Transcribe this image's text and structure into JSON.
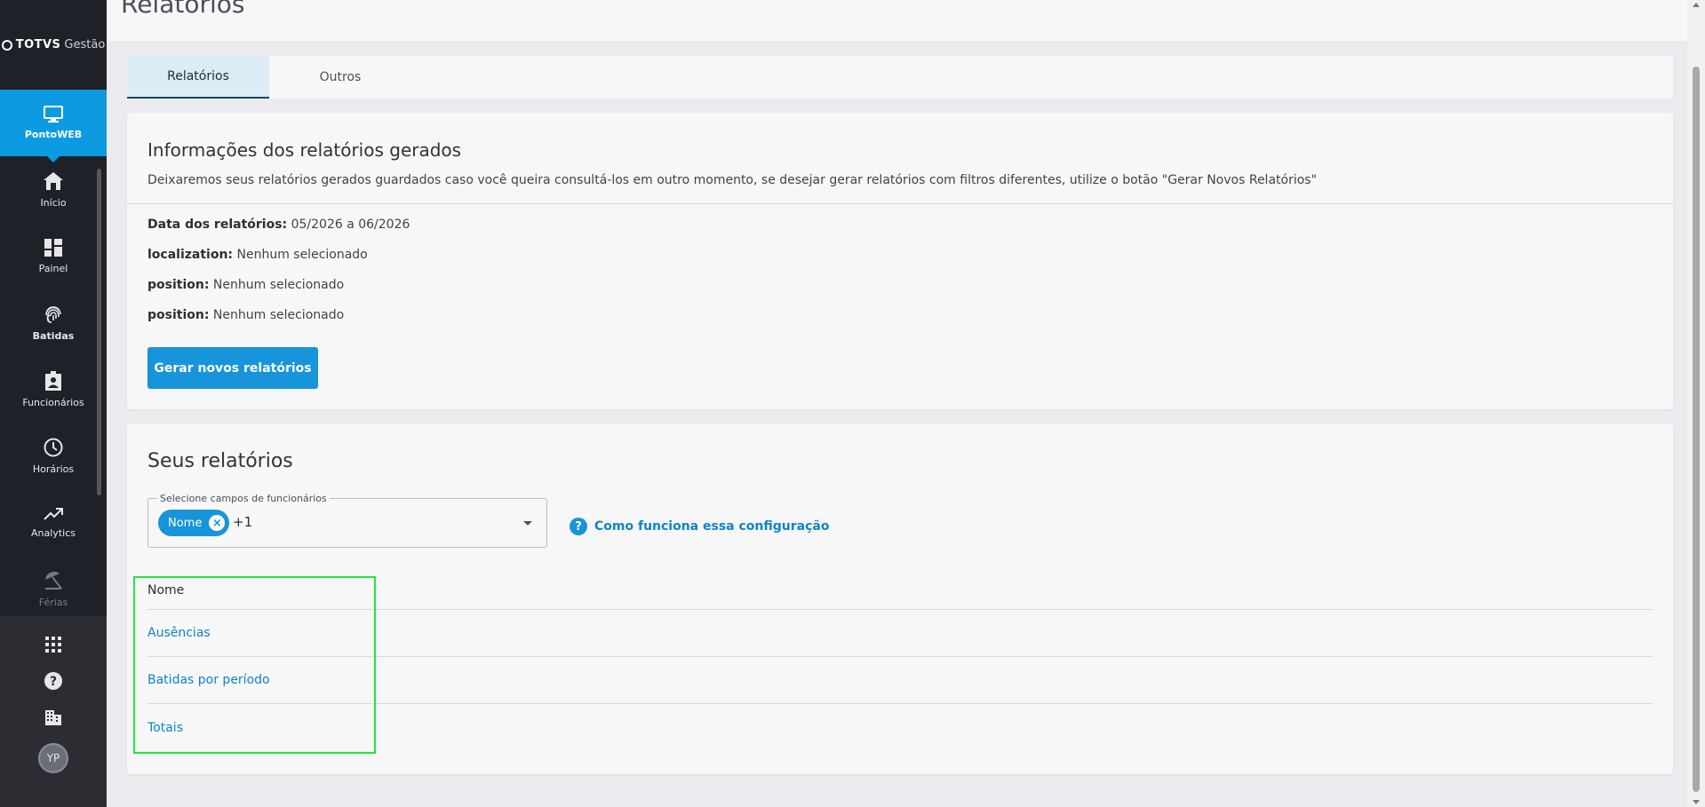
{
  "brand": {
    "name": "TOTVS",
    "suffix": "Gestão"
  },
  "sidebar": {
    "active_module": {
      "label": "PontoWEB",
      "icon": "monitor-icon"
    },
    "items": [
      {
        "label": "Início",
        "icon": "home-icon"
      },
      {
        "label": "Painel",
        "icon": "dashboard-icon"
      },
      {
        "label": "Batidas",
        "icon": "fingerprint-icon"
      },
      {
        "label": "Funcionários",
        "icon": "badge-icon"
      },
      {
        "label": "Horários",
        "icon": "clock-icon"
      },
      {
        "label": "Analytics",
        "icon": "trending-up-icon"
      },
      {
        "label": "Férias",
        "icon": "beach-umbrella-icon"
      }
    ],
    "bottom": {
      "apps_icon": "apps-grid-icon",
      "help_icon": "help-icon",
      "company_icon": "building-icon",
      "avatar_initials": "YP"
    }
  },
  "page": {
    "title": "Relatórios"
  },
  "tabs": [
    {
      "label": "Relatórios",
      "active": true
    },
    {
      "label": "Outros",
      "active": false
    }
  ],
  "info_card": {
    "title": "Informações dos relatórios gerados",
    "description": "Deixaremos seus relatórios gerados guardados caso você queira consultá-los em outro momento, se desejar gerar relatórios com filtros diferentes, utilize o botão \"Gerar Novos Relatórios\"",
    "fields": [
      {
        "label": "Data dos relatórios:",
        "value": "05/2026 a 06/2026"
      },
      {
        "label": "localization:",
        "value": "Nenhum selecionado"
      },
      {
        "label": "position:",
        "value": "Nenhum selecionado"
      },
      {
        "label": "position:",
        "value": "Nenhum selecionado"
      }
    ],
    "button_label": "Gerar novos relatórios"
  },
  "reports_card": {
    "title": "Seus relatórios",
    "select": {
      "legend": "Selecione campos de funcionários",
      "chip_label": "Nome",
      "more_count": "+1"
    },
    "help_link": "Como funciona essa configuração",
    "table_header": "Nome",
    "rows": [
      "Ausências",
      "Batidas por período",
      "Totais"
    ]
  },
  "colors": {
    "accent": "#1894da",
    "sidebar_bg": "#1f2128",
    "highlight": "#22e63f"
  }
}
